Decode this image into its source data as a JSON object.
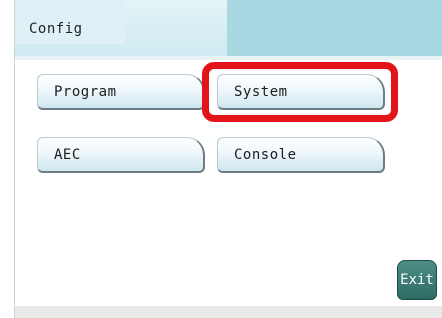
{
  "header": {
    "title": "Config"
  },
  "buttons": {
    "program": "Program",
    "system": "System",
    "aec": "AEC",
    "console": "Console",
    "exit": "Exit"
  },
  "colors": {
    "header_bg": "#a9d8e3",
    "highlight": "#e3151b",
    "exit_button": "#3b7a73"
  }
}
